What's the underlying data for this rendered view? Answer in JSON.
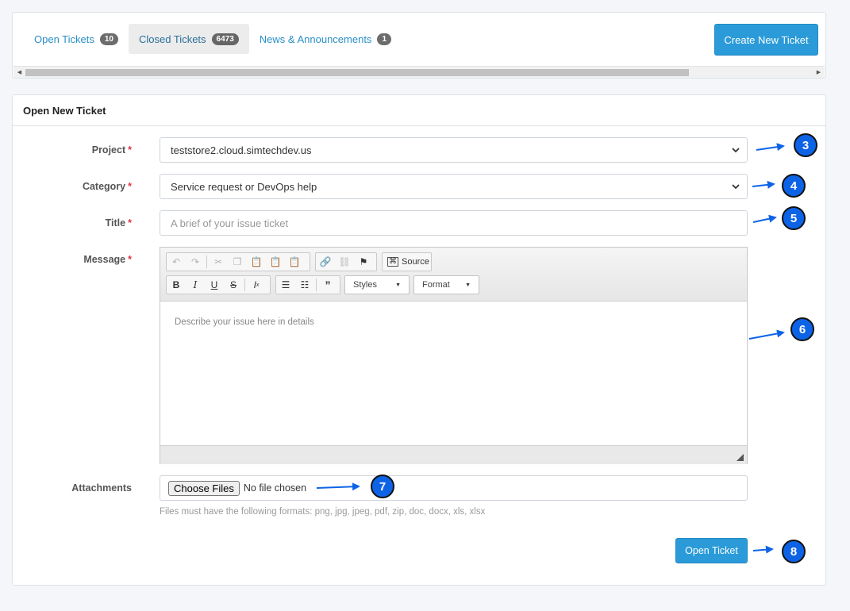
{
  "tabs": [
    {
      "label": "Open Tickets",
      "count": "10"
    },
    {
      "label": "Closed Tickets",
      "count": "6473"
    },
    {
      "label": "News & Announcements",
      "count": "1"
    }
  ],
  "create_button": "Create New Ticket",
  "form": {
    "header": "Open New Ticket",
    "project": {
      "label": "Project",
      "value": "teststore2.cloud.simtechdev.us"
    },
    "category": {
      "label": "Category",
      "value": "Service request or DevOps help"
    },
    "title": {
      "label": "Title",
      "placeholder": "A brief of your issue ticket"
    },
    "message": {
      "label": "Message",
      "placeholder": "Describe your issue here in details",
      "toolbar": {
        "source": "Source",
        "styles": "Styles",
        "format": "Format"
      }
    },
    "attachments": {
      "label": "Attachments",
      "choose": "Choose Files",
      "no_file": "No file chosen",
      "help": "Files must have the following formats: png, jpg, jpeg, pdf, zip, doc, docx, xls, xlsx"
    },
    "required_mark": "*",
    "submit": "Open Ticket"
  },
  "callouts": [
    "3",
    "4",
    "5",
    "6",
    "7",
    "8"
  ],
  "colors": {
    "accent": "#2a9bd8",
    "callout": "#0d63e6",
    "required": "#dc3545"
  }
}
